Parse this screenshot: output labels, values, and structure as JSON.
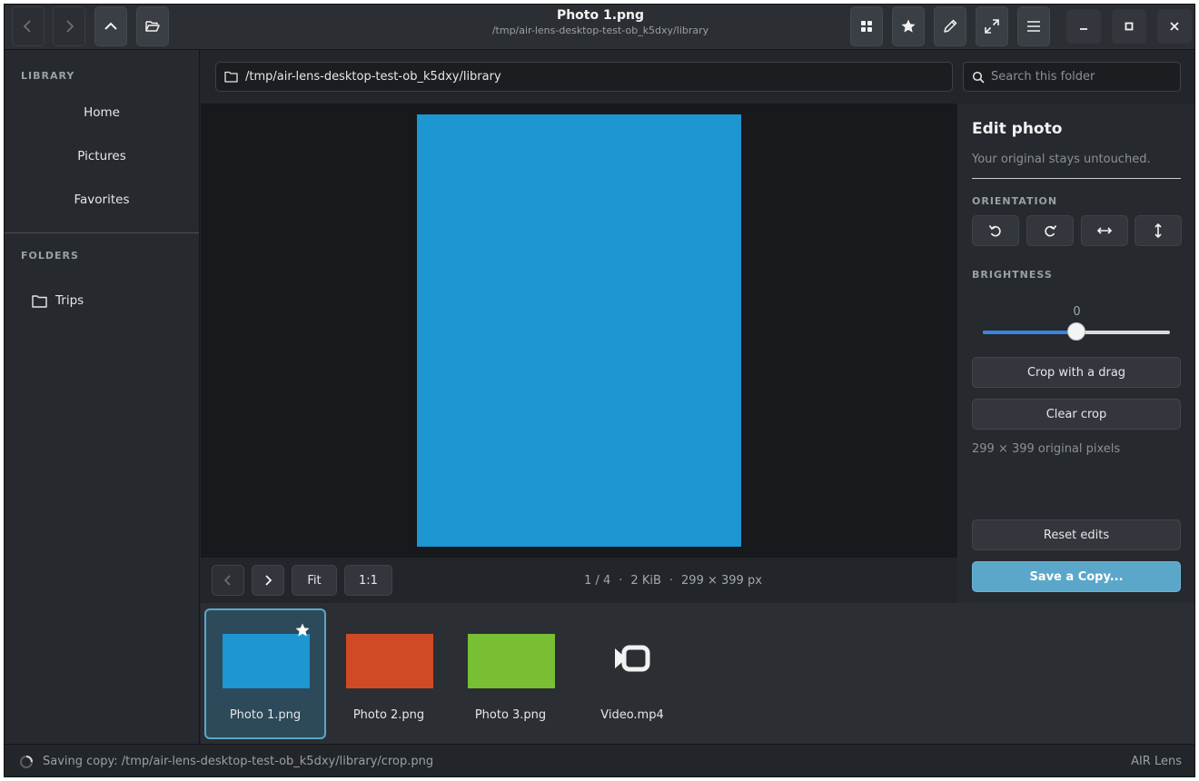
{
  "header": {
    "title": "Photo 1.png",
    "subtitle": "/tmp/air-lens-desktop-test-ob_k5dxy/library",
    "buttons": {
      "back": "chevron-left-icon",
      "forward": "chevron-right-icon",
      "up": "chevron-up-icon",
      "open_folder": "folder-open-icon",
      "grid_view": "grid-icon",
      "favorite": "star-icon",
      "edit": "pencil-icon",
      "fullscreen": "expand-icon",
      "menu": "hamburger-icon",
      "minimize": "minimize-icon",
      "maximize": "maximize-icon",
      "close": "close-icon"
    }
  },
  "sidebar": {
    "library_label": "LIBRARY",
    "library_items": [
      {
        "label": "Home"
      },
      {
        "label": "Pictures"
      },
      {
        "label": "Favorites"
      }
    ],
    "folders_label": "FOLDERS",
    "folders": [
      {
        "label": "Trips",
        "icon": "folder-icon"
      }
    ]
  },
  "pathbar": {
    "path": "/tmp/air-lens-desktop-test-ob_k5dxy/library"
  },
  "search": {
    "placeholder": "Search this folder",
    "value": ""
  },
  "viewer": {
    "photo_color": "#1e96d1",
    "nav": {
      "fit_label": "Fit",
      "actual_label": "1:1"
    },
    "info": {
      "position": "1 / 4",
      "size": "2 KiB",
      "dimensions": "299 × 399 px",
      "separator": "·"
    }
  },
  "edit_panel": {
    "title": "Edit photo",
    "subtitle": "Your original stays untouched.",
    "orientation_label": "ORIENTATION",
    "orientation_buttons": [
      "rotate-left-icon",
      "rotate-right-icon",
      "flip-horizontal-icon",
      "flip-vertical-icon"
    ],
    "brightness_label": "BRIGHTNESS",
    "brightness_value": "0",
    "brightness_fraction": 0.5,
    "crop_label": "Crop with a drag",
    "clear_crop_label": "Clear crop",
    "dimensions": "299 × 399 original pixels",
    "reset_label": "Reset edits",
    "save_label": "Save a Copy..."
  },
  "filmstrip": {
    "items": [
      {
        "label": "Photo 1.png",
        "color": "#1e96d1",
        "selected": true,
        "favorite": true
      },
      {
        "label": "Photo 2.png",
        "color": "#d14a26",
        "selected": false,
        "favorite": false
      },
      {
        "label": "Photo 3.png",
        "color": "#78bf34",
        "selected": false,
        "favorite": false
      },
      {
        "label": "Video.mp4",
        "icon": "video-camera-icon",
        "selected": false,
        "favorite": false
      }
    ]
  },
  "status": {
    "text": "Saving copy: /tmp/air-lens-desktop-test-ob_k5dxy/library/crop.png",
    "app_name": "AIR Lens"
  }
}
